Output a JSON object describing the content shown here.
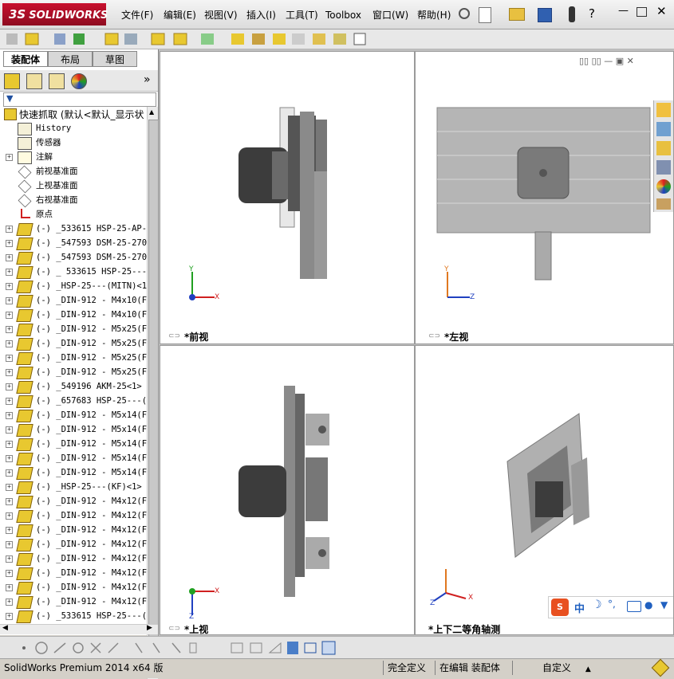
{
  "app": {
    "logo": "SOLIDWORKS",
    "logo_prefix": "3S"
  },
  "menu": [
    "文件(F)",
    "编辑(E)",
    "视图(V)",
    "插入(I)",
    "工具(T)",
    "Toolbox",
    "窗口(W)",
    "帮助(H)"
  ],
  "panel_tabs": [
    "装配体",
    "布局",
    "草图"
  ],
  "tree": {
    "root": "快速抓取  (默认<默认_显示状",
    "items": [
      {
        "label": "History",
        "icon": "history-icon",
        "expand": false
      },
      {
        "label": "传感器",
        "icon": "sensor-icon",
        "expand": false
      },
      {
        "label": "注解",
        "icon": "annotation-icon",
        "expand": true
      },
      {
        "label": "前视基准面",
        "icon": "plane-icon",
        "expand": false
      },
      {
        "label": "上视基准面",
        "icon": "plane-icon",
        "expand": false
      },
      {
        "label": "右视基准面",
        "icon": "plane-icon",
        "expand": false
      },
      {
        "label": "原点",
        "icon": "origin-icon",
        "expand": false
      },
      {
        "label": "(-) _533615 HSP-25-AP--",
        "icon": "part-icon",
        "expand": true
      },
      {
        "label": "(-) _547593 DSM-25-270-",
        "icon": "part-icon",
        "expand": true
      },
      {
        "label": "(-) _547593 DSM-25-270-",
        "icon": "part-icon",
        "expand": true
      },
      {
        "label": "(-) _ 533615 HSP-25---(",
        "icon": "part-icon",
        "expand": true
      },
      {
        "label": "(-) _HSP-25---(MITN)<1>",
        "icon": "part-icon",
        "expand": true
      },
      {
        "label": "(-) _DIN-912 - M4x10(F)",
        "icon": "part-icon",
        "expand": true
      },
      {
        "label": "(-) _DIN-912 - M4x10(F)",
        "icon": "part-icon",
        "expand": true
      },
      {
        "label": "(-) _DIN-912 - M5x25(F)",
        "icon": "part-icon",
        "expand": true
      },
      {
        "label": "(-) _DIN-912 - M5x25(F)",
        "icon": "part-icon",
        "expand": true
      },
      {
        "label": "(-) _DIN-912 - M5x25(F)",
        "icon": "part-icon",
        "expand": true
      },
      {
        "label": "(-) _DIN-912 - M5x25(F)",
        "icon": "part-icon",
        "expand": true
      },
      {
        "label": "(-) _549196 AKM-25<1> (",
        "icon": "part-icon",
        "expand": true
      },
      {
        "label": "(-) _657683 HSP-25---(U",
        "icon": "part-icon",
        "expand": true
      },
      {
        "label": "(-) _DIN-912 - M5x14(F)",
        "icon": "part-icon",
        "expand": true
      },
      {
        "label": "(-) _DIN-912 - M5x14(F)",
        "icon": "part-icon",
        "expand": true
      },
      {
        "label": "(-) _DIN-912 - M5x14(F)",
        "icon": "part-icon",
        "expand": true
      },
      {
        "label": "(-) _DIN-912 - M5x14(F)",
        "icon": "part-icon",
        "expand": true
      },
      {
        "label": "(-) _DIN-912 - M5x14(F)",
        "icon": "part-icon",
        "expand": true
      },
      {
        "label": "(-) _HSP-25---(KF)<1> (",
        "icon": "part-icon",
        "expand": true
      },
      {
        "label": "(-) _DIN-912 - M4x12(F)",
        "icon": "part-icon",
        "expand": true
      },
      {
        "label": "(-) _DIN-912 - M4x12(F)",
        "icon": "part-icon",
        "expand": true
      },
      {
        "label": "(-) _DIN-912 - M4x12(F)",
        "icon": "part-icon",
        "expand": true
      },
      {
        "label": "(-) _DIN-912 - M4x12(F)",
        "icon": "part-icon",
        "expand": true
      },
      {
        "label": "(-) _DIN-912 - M4x12(F)",
        "icon": "part-icon",
        "expand": true
      },
      {
        "label": "(-) _DIN-912 - M4x12(F)",
        "icon": "part-icon",
        "expand": true
      },
      {
        "label": "(-) _DIN-912 - M4x12(F)",
        "icon": "part-icon",
        "expand": true
      },
      {
        "label": "(-) _DIN-912 - M4x12(F)",
        "icon": "part-icon",
        "expand": true
      },
      {
        "label": "(-) _533615 HSP-25---(K",
        "icon": "part-icon",
        "expand": true
      }
    ]
  },
  "viewports": {
    "front": "*前视",
    "left": "*左视",
    "top": "*上视",
    "iso": "*上下二等角轴测"
  },
  "axes": {
    "x": "X",
    "y": "Y",
    "z": "Z"
  },
  "ime": {
    "label": "中",
    "extra": "°,"
  },
  "status": {
    "version": "SolidWorks Premium 2014 x64 版",
    "defined": "完全定义",
    "editing": "在编辑 装配体",
    "custom": "自定义"
  },
  "colors": {
    "brand": "#c8102e",
    "axis_x": "#d02020",
    "axis_y": "#20a020",
    "axis_z": "#2040c0",
    "part_yellow": "#e8c830"
  }
}
